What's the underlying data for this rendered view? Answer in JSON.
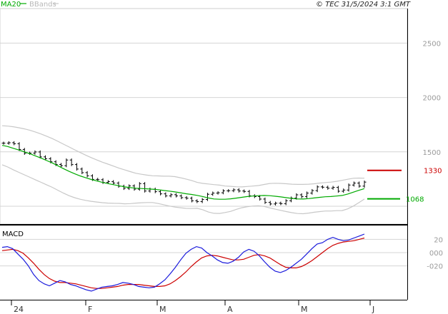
{
  "header": {
    "legend_ma20": "MA20",
    "legend_bbands": "BBands",
    "source": "© TEC 31/5/2024 3:1 GMT"
  },
  "colors": {
    "ma20": "#00aa00",
    "bbands": "#c8c8c8",
    "bars": "#000000",
    "resistance": "#cc0000",
    "support": "#00aa00",
    "macd": "#1a1adc",
    "signal": "#cc0000",
    "grid": "#d4d4d4"
  },
  "levels": {
    "resistance": {
      "label": "1330",
      "value": 1330
    },
    "support": {
      "label": "1068",
      "value": 1068
    }
  },
  "macd_panel": {
    "title": "MACD"
  },
  "chart_data": [
    {
      "type": "line",
      "panel": "price",
      "ylim": [
        1000,
        2700
      ],
      "yticks": [
        1500,
        2000,
        2500
      ],
      "ytick_labels": [
        "1500",
        "2000",
        "2500"
      ],
      "grid": true,
      "legend": "top-left",
      "x_labels": [
        "24",
        "F",
        "M",
        "A",
        "M",
        "J"
      ],
      "series": [
        {
          "name": "MA20",
          "values": [
            1560,
            1549,
            1533,
            1517,
            1500,
            1482,
            1462,
            1442,
            1420,
            1398,
            1372,
            1346,
            1321,
            1299,
            1279,
            1262,
            1246,
            1232,
            1219,
            1208,
            1198,
            1188,
            1178,
            1171,
            1166,
            1163,
            1160,
            1157,
            1152,
            1145,
            1139,
            1132,
            1124,
            1115,
            1108,
            1100,
            1089,
            1076,
            1067,
            1064,
            1064,
            1068,
            1075,
            1082,
            1089,
            1094,
            1097,
            1099,
            1097,
            1092,
            1086,
            1079,
            1072,
            1067,
            1066,
            1070,
            1076,
            1082,
            1087,
            1089,
            1094,
            1099,
            1112,
            1129,
            1146,
            1162
          ]
        },
        {
          "name": "BBands",
          "values": [
            1740,
            1737,
            1731,
            1722,
            1711,
            1698,
            1682,
            1664,
            1644,
            1622,
            1597,
            1571,
            1545,
            1519,
            1494,
            1470,
            1447,
            1425,
            1405,
            1387,
            1369,
            1350,
            1334,
            1318,
            1303,
            1294,
            1286,
            1280,
            1279,
            1276,
            1276,
            1272,
            1262,
            1250,
            1237,
            1219,
            1210,
            1205,
            1199,
            1194,
            1186,
            1183,
            1179,
            1178,
            1182,
            1186,
            1190,
            1200,
            1209,
            1211,
            1210,
            1207,
            1203,
            1201,
            1201,
            1203,
            1207,
            1213,
            1218,
            1222,
            1229,
            1238,
            1248,
            1257,
            1259,
            1258
          ]
        },
        {
          "name": "BBands lower",
          "values": [
            1381,
            1361,
            1335,
            1312,
            1289,
            1266,
            1242,
            1220,
            1196,
            1174,
            1147,
            1121,
            1097,
            1079,
            1064,
            1054,
            1045,
            1039,
            1033,
            1029,
            1027,
            1026,
            1022,
            1024,
            1029,
            1032,
            1034,
            1034,
            1025,
            1014,
            1002,
            992,
            986,
            980,
            979,
            981,
            968,
            947,
            935,
            934,
            942,
            953,
            971,
            986,
            996,
            1002,
            1004,
            998,
            985,
            973,
            962,
            951,
            941,
            933,
            931,
            937,
            945,
            951,
            956,
            956,
            959,
            960,
            976,
            1001,
            1033,
            1066
          ]
        },
        {
          "name": "Price",
          "values": [
            1580,
            1584,
            1575,
            1522,
            1487,
            1488,
            1499,
            1454,
            1437,
            1409,
            1384,
            1373,
            1425,
            1383,
            1342,
            1309,
            1280,
            1247,
            1244,
            1219,
            1226,
            1213,
            1184,
            1164,
            1187,
            1157,
            1208,
            1140,
            1157,
            1134,
            1114,
            1095,
            1106,
            1095,
            1079,
            1074,
            1050,
            1043,
            1062,
            1110,
            1121,
            1124,
            1142,
            1143,
            1151,
            1140,
            1136,
            1096,
            1089,
            1066,
            1035,
            1021,
            1028,
            1024,
            1051,
            1075,
            1105,
            1088,
            1121,
            1144,
            1178,
            1175,
            1166,
            1173,
            1138,
            1149,
            1195,
            1213,
            1185,
            1222
          ]
        }
      ]
    },
    {
      "type": "line",
      "panel": "macd",
      "ylim": [
        -42,
        42
      ],
      "yticks": [
        20,
        0,
        -20
      ],
      "ytick_labels": [
        "20",
        "000",
        "-020"
      ],
      "series": [
        {
          "name": "MACD",
          "values": [
            8,
            9,
            6,
            -2,
            -10,
            -20,
            -33,
            -42,
            -47,
            -50,
            -46,
            -42,
            -44,
            -48,
            -50,
            -53,
            -56,
            -58,
            -55,
            -52,
            -51,
            -50,
            -48,
            -45,
            -46,
            -48,
            -51,
            -52,
            -53,
            -52,
            -47,
            -41,
            -32,
            -22,
            -11,
            -1,
            5,
            9,
            7,
            0,
            -5,
            -11,
            -15,
            -16,
            -13,
            -7,
            1,
            5,
            2,
            -5,
            -14,
            -22,
            -28,
            -30,
            -27,
            -22,
            -16,
            -10,
            -2,
            6,
            13,
            15,
            20,
            23,
            20,
            18,
            19,
            22,
            25,
            28
          ]
        },
        {
          "name": "Signal",
          "values": [
            3,
            4,
            5,
            3,
            -1,
            -8,
            -16,
            -25,
            -33,
            -39,
            -43,
            -45,
            -45,
            -46,
            -47,
            -49,
            -51,
            -53,
            -54,
            -54,
            -53,
            -52,
            -51,
            -49,
            -48,
            -48,
            -48,
            -49,
            -50,
            -51,
            -51,
            -50,
            -47,
            -42,
            -36,
            -29,
            -21,
            -14,
            -8,
            -5,
            -4,
            -5,
            -7,
            -9,
            -11,
            -11,
            -10,
            -7,
            -4,
            -3,
            -5,
            -8,
            -13,
            -18,
            -22,
            -23,
            -23,
            -21,
            -17,
            -12,
            -6,
            0,
            6,
            11,
            14,
            16,
            17,
            18,
            20,
            22
          ]
        }
      ]
    }
  ]
}
